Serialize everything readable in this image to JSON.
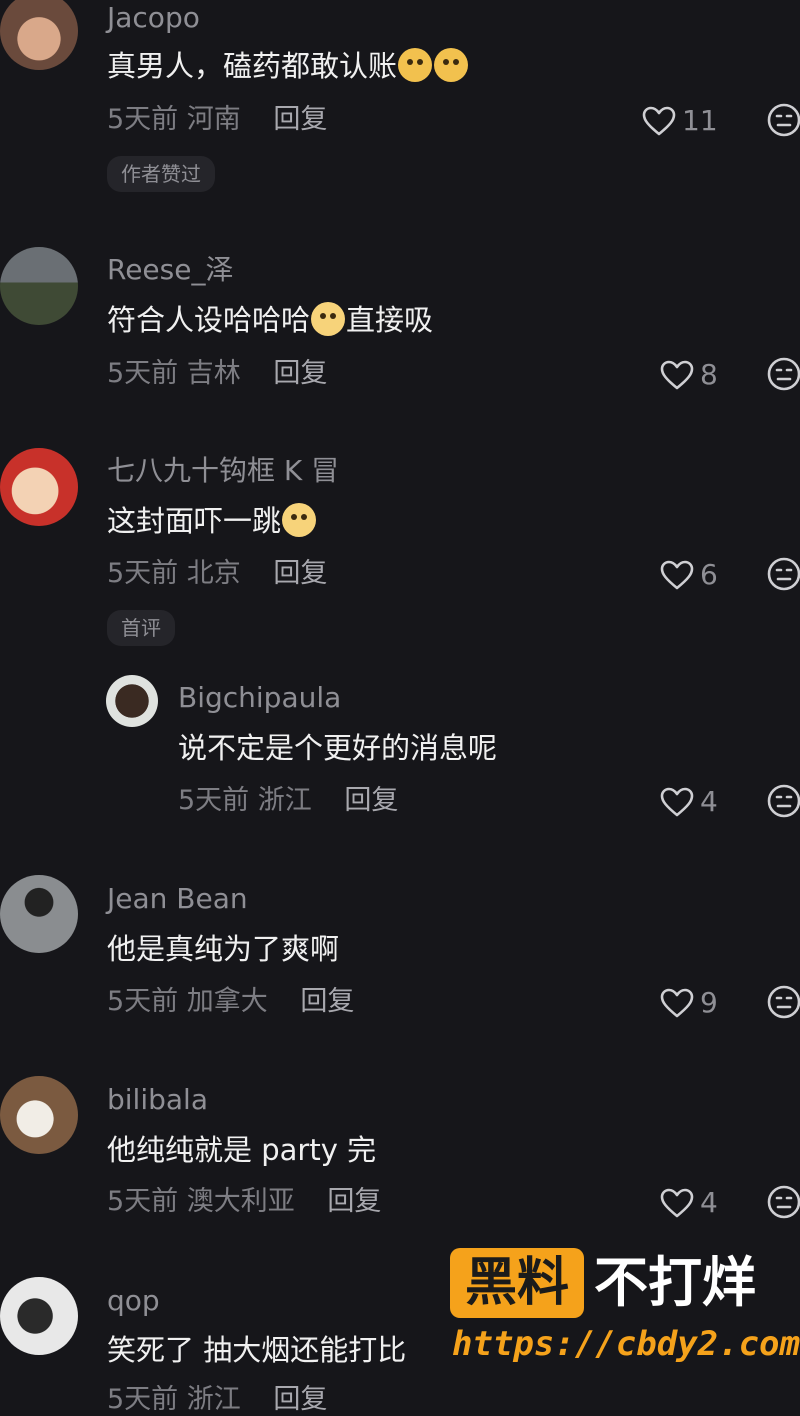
{
  "comments": [
    {
      "user": "Jacopo",
      "text": "真男人，磕药都敢认账",
      "time": "5天前",
      "location": "河南",
      "reply": "回复",
      "likes": "11",
      "tag": "作者赞过"
    },
    {
      "user": "Reese_泽",
      "text_a": "符合人设哈哈哈",
      "text_b": "直接吸",
      "time": "5天前",
      "location": "吉林",
      "reply": "回复",
      "likes": "8"
    },
    {
      "user": "七八九十钩框 K 冒",
      "text": "这封面吓一跳",
      "time": "5天前",
      "location": "北京",
      "reply": "回复",
      "likes": "6",
      "tag": "首评"
    },
    {
      "user": "Jean Bean",
      "text": "他是真纯为了爽啊",
      "time": "5天前",
      "location": "加拿大",
      "reply": "回复",
      "likes": "9"
    },
    {
      "user": "bilibala",
      "text": "他纯纯就是 party 完",
      "time": "5天前",
      "location": "澳大利亚",
      "reply": "回复",
      "likes": "4"
    },
    {
      "user": "qop",
      "text": "笑死了 抽大烟还能打比",
      "time": "5天前",
      "location": "浙江",
      "reply": "回复"
    }
  ],
  "reply_comment": {
    "user": "Bigchipaula",
    "text": "说不定是个更好的消息呢",
    "time": "5天前",
    "location": "浙江",
    "reply": "回复",
    "likes": "4"
  },
  "watermark": {
    "box": "黑料",
    "side": "不打烊",
    "url": "https://cbdy2.com"
  }
}
